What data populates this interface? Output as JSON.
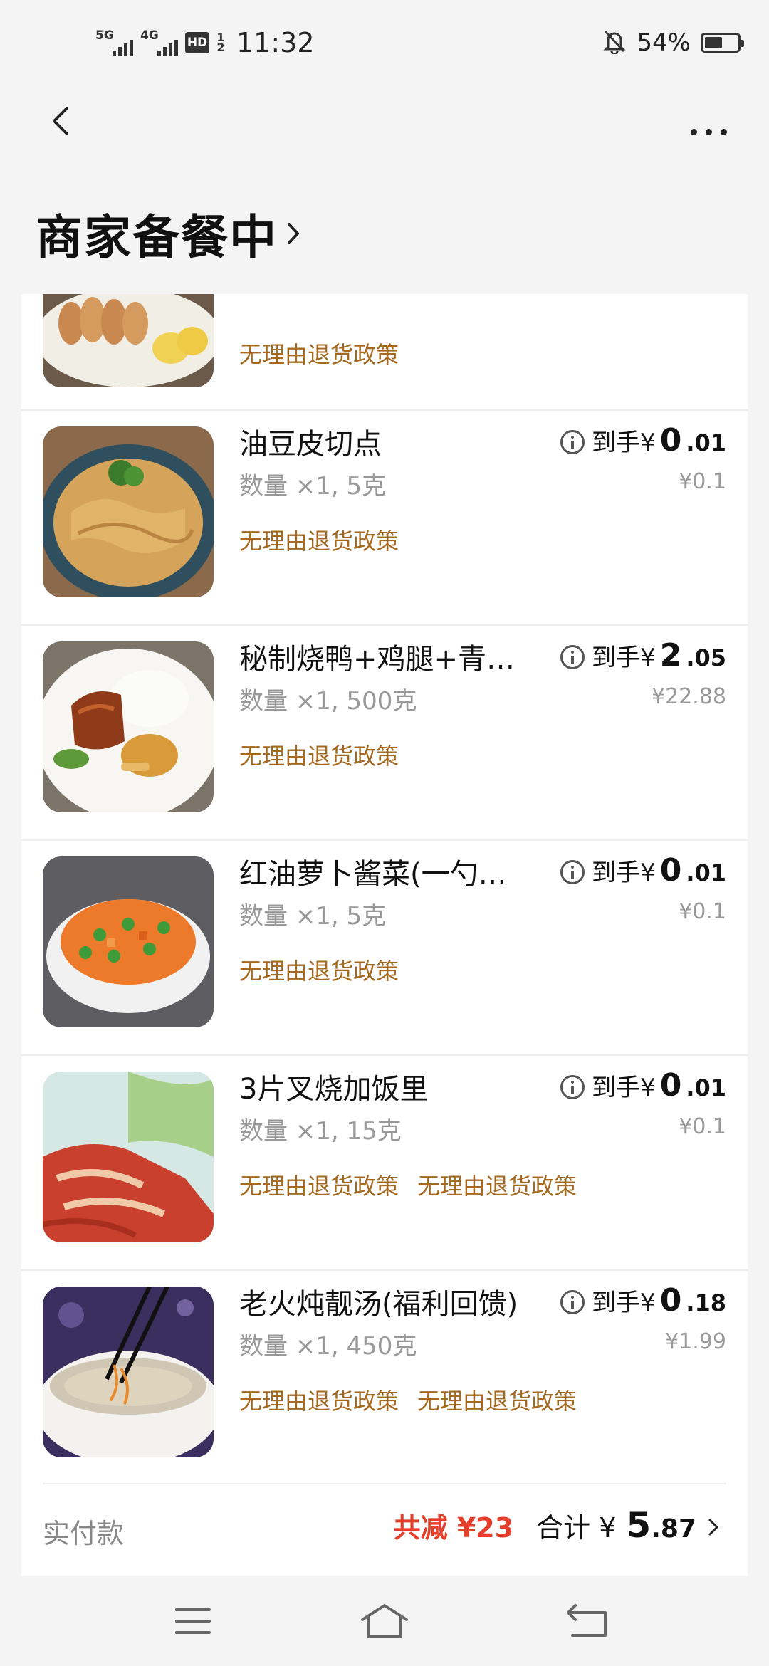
{
  "status_bar": {
    "signal1_label": "5G",
    "signal2_label": "4G",
    "hd_label": "HD",
    "hd_sub": "1 2",
    "time": "11:32",
    "battery_percent": "54%",
    "battery_level": 0.54
  },
  "header": {
    "title": "商家备餐中"
  },
  "items": [
    {
      "name": "",
      "qty": "",
      "policies": [
        "无理由退货政策"
      ],
      "price_prefix": "",
      "price_int": "",
      "price_dec": "",
      "original_price": "",
      "image": "food-pork-rice"
    },
    {
      "name": "油豆皮切点",
      "qty": "数量 ×1, 5克",
      "policies": [
        "无理由退货政策"
      ],
      "price_prefix": "到手¥",
      "price_int": "0",
      "price_dec": ".01",
      "original_price": "¥0.1",
      "image": "food-tofu-skin"
    },
    {
      "name": "秘制烧鸭+鸡腿+青…",
      "qty": "数量 ×1, 500克",
      "policies": [
        "无理由退货政策"
      ],
      "price_prefix": "到手¥",
      "price_int": "2",
      "price_dec": ".05",
      "original_price": "¥22.88",
      "image": "food-roast-duck"
    },
    {
      "name": "红油萝卜酱菜(一勺…",
      "qty": "数量 ×1, 5克",
      "policies": [
        "无理由退货政策"
      ],
      "price_prefix": "到手¥",
      "price_int": "0",
      "price_dec": ".01",
      "original_price": "¥0.1",
      "image": "food-carrot-pickle"
    },
    {
      "name": "3片叉烧加饭里",
      "qty": "数量 ×1, 15克",
      "policies": [
        "无理由退货政策",
        "无理由退货政策"
      ],
      "price_prefix": "到手¥",
      "price_int": "0",
      "price_dec": ".01",
      "original_price": "¥0.1",
      "image": "food-char-siu"
    },
    {
      "name": "老火炖靓汤(福利回馈)",
      "qty": "数量 ×1, 450克",
      "policies": [
        "无理由退货政策",
        "无理由退货政策"
      ],
      "price_prefix": "到手¥",
      "price_int": "0",
      "price_dec": ".18",
      "original_price": "¥1.99",
      "image": "food-soup"
    }
  ],
  "footer": {
    "label": "实付款",
    "discount": "共减 ¥23",
    "total_label": "合计 ¥",
    "total_int": "5",
    "total_dec": ".87"
  },
  "colors": {
    "policy": "#a4681f",
    "discount": "#e53e2b",
    "background": "#f4f4f5"
  },
  "nav_icons": [
    "menu-icon",
    "home-icon",
    "back-return-icon"
  ]
}
